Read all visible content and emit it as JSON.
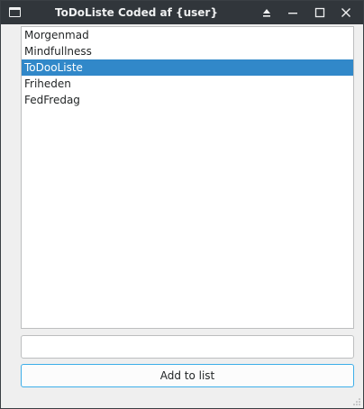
{
  "window": {
    "title": "ToDoListe Coded af {user}",
    "icon": "window-app-icon",
    "controls": [
      "keep-above-icon",
      "minimize-icon",
      "maximize-icon",
      "close-icon"
    ]
  },
  "list": {
    "items": [
      {
        "label": "Morgenmad",
        "selected": false
      },
      {
        "label": "Mindfullness",
        "selected": false
      },
      {
        "label": "ToDooListe",
        "selected": true
      },
      {
        "label": "Friheden",
        "selected": false
      },
      {
        "label": "FedFredag",
        "selected": false
      }
    ]
  },
  "input": {
    "value": "",
    "placeholder": ""
  },
  "add_button": {
    "label": "Add to list"
  },
  "colors": {
    "titlebar": "#31363b",
    "selection": "#3188c9",
    "focus_border": "#3daee9",
    "window_bg": "#efefef"
  }
}
